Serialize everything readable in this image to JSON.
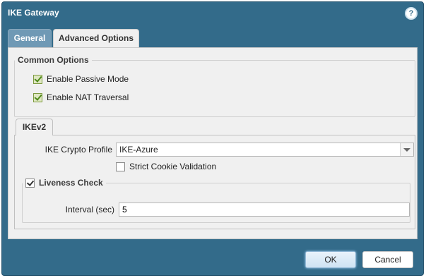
{
  "dialog": {
    "title": "IKE Gateway",
    "help_icon": "help-icon",
    "help_glyph": "?"
  },
  "tabs": [
    {
      "label": "General",
      "active": false
    },
    {
      "label": "Advanced Options",
      "active": true
    }
  ],
  "common_options": {
    "legend": "Common Options",
    "passive_mode": {
      "label": "Enable Passive Mode",
      "checked": true
    },
    "nat_traversal": {
      "label": "Enable NAT Traversal",
      "checked": true
    }
  },
  "ikev2": {
    "tab_label": "IKEv2",
    "crypto_profile_label": "IKE Crypto Profile",
    "crypto_profile_value": "IKE-Azure",
    "strict_cookie": {
      "label": "Strict Cookie Validation",
      "checked": false
    },
    "liveness": {
      "legend": "Liveness Check",
      "checked": true,
      "interval_label": "Interval (sec)",
      "interval_value": "5"
    }
  },
  "buttons": {
    "ok": "OK",
    "cancel": "Cancel"
  },
  "colors": {
    "dialog_bg": "#336b8a",
    "content_bg": "#f0f0f0",
    "check_green": "#4f8a1a"
  }
}
